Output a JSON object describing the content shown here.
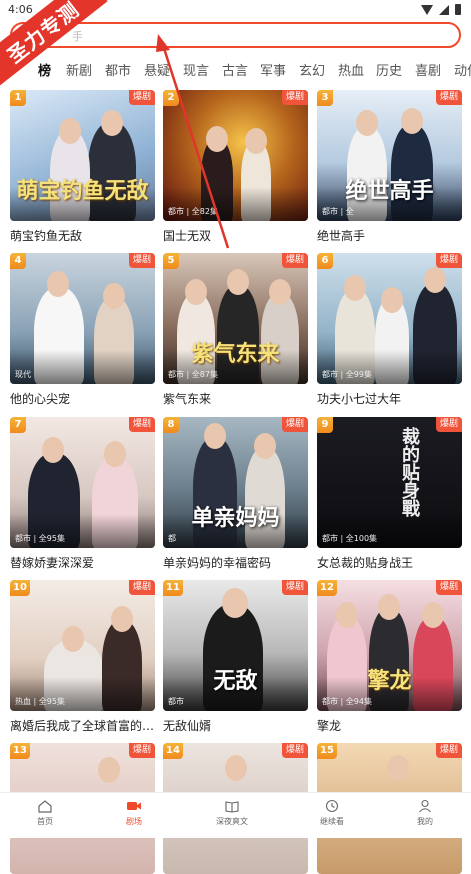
{
  "status_bar": {
    "time": "4:06"
  },
  "search": {
    "placeholder": "手"
  },
  "watermark": {
    "text": "圣力专测"
  },
  "tabs": [
    "榜",
    "新剧",
    "都市",
    "悬疑",
    "现言",
    "古言",
    "军事",
    "玄幻",
    "热血",
    "历史",
    "喜剧",
    "动作"
  ],
  "active_tab": "榜",
  "badge_label": "爆剧",
  "dramas": [
    {
      "rank": "1",
      "title": "萌宝钓鱼无敌",
      "poster_text": "萌宝钓鱼无敌",
      "meta": ""
    },
    {
      "rank": "2",
      "title": "国士无双",
      "poster_text": "",
      "meta": "都市 | 全82集"
    },
    {
      "rank": "3",
      "title": "绝世高手",
      "poster_text": "绝世高手",
      "meta": "都市 | 全"
    },
    {
      "rank": "4",
      "title": "他的心尖宠",
      "poster_text": "",
      "meta": "现代"
    },
    {
      "rank": "5",
      "title": "紫气东来",
      "poster_text": "紫气东来",
      "meta": "都市 | 全87集"
    },
    {
      "rank": "6",
      "title": "功夫小七过大年",
      "poster_text": "",
      "meta": "都市 | 全99集"
    },
    {
      "rank": "7",
      "title": "替嫁娇妻深深爱",
      "poster_text": "",
      "meta": "都市 | 全95集"
    },
    {
      "rank": "8",
      "title": "单亲妈妈的幸福密码",
      "poster_text": "单亲妈妈",
      "meta": "都"
    },
    {
      "rank": "9",
      "title": "女总裁的贴身战王",
      "poster_text": "裁的贴身戰",
      "meta": "都市 | 全100集"
    },
    {
      "rank": "10",
      "title": "离婚后我成了全球首富的外...",
      "poster_text": "",
      "meta": "热血 | 全95集"
    },
    {
      "rank": "11",
      "title": "无敌仙婿",
      "poster_text": "无敌",
      "meta": "都市"
    },
    {
      "rank": "12",
      "title": "擎龙",
      "poster_text": "擎龙",
      "meta": "都市 | 全94集"
    },
    {
      "rank": "13",
      "title": "",
      "poster_text": "",
      "meta": ""
    },
    {
      "rank": "14",
      "title": "",
      "poster_text": "",
      "meta": ""
    },
    {
      "rank": "15",
      "title": "",
      "poster_text": "",
      "meta": ""
    }
  ],
  "bottom_nav": [
    {
      "label": "首页",
      "icon": "home-icon"
    },
    {
      "label": "剧场",
      "icon": "video-icon"
    },
    {
      "label": "深夜爽文",
      "icon": "book-icon"
    },
    {
      "label": "继续看",
      "icon": "clock-icon"
    },
    {
      "label": "我的",
      "icon": "user-icon"
    }
  ],
  "colors": {
    "accent": "#f04a2a",
    "badge": "#f0543a",
    "watermark": "#e4352a"
  }
}
